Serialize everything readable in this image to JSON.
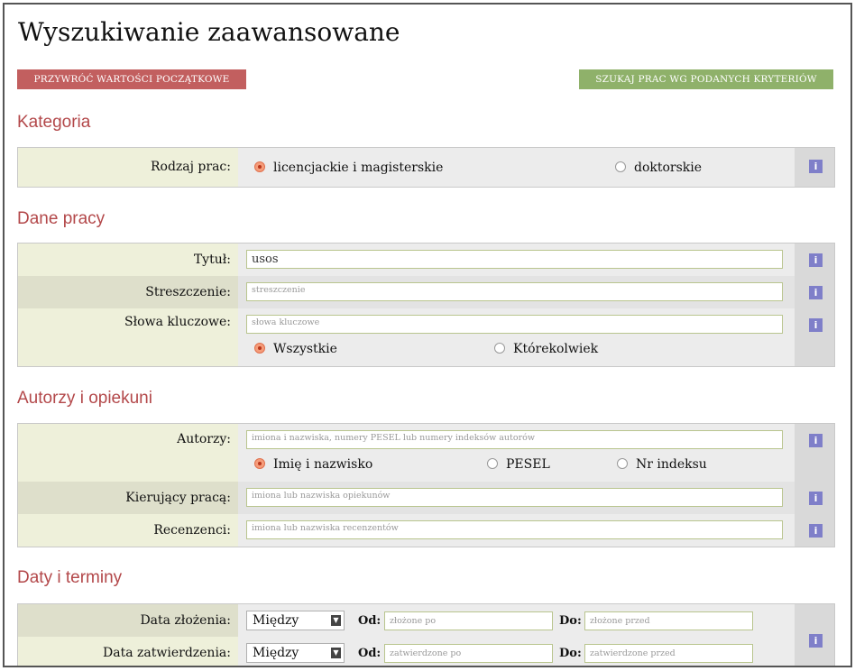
{
  "page": {
    "title": "Wyszukiwanie zaawansowane",
    "reset_label": "PRZYWRÓĆ WARTOŚCI POCZĄTKOWE",
    "search_label": "SZUKAJ PRAC WG PODANYCH KRYTERIÓW"
  },
  "info_icon": "i",
  "kategoria": {
    "title": "Kategoria",
    "rodzaj_label": "Rodzaj prac:",
    "options": [
      "licencjackie i magisterskie",
      "doktorskie"
    ],
    "selected": 0
  },
  "dane": {
    "title": "Dane pracy",
    "tytul_label": "Tytuł:",
    "tytul_value": "usos",
    "streszczenie_label": "Streszczenie:",
    "streszczenie_placeholder": "streszczenie",
    "slowa_label": "Słowa kluczowe:",
    "slowa_placeholder": "słowa kluczowe",
    "match_options": [
      "Wszystkie",
      "Którekolwiek"
    ],
    "match_selected": 0
  },
  "autorzy": {
    "title": "Autorzy i opiekuni",
    "autorzy_label": "Autorzy:",
    "autorzy_placeholder": "imiona i nazwiska, numery PESEL lub numery indeksów autorów",
    "type_options": [
      "Imię i nazwisko",
      "PESEL",
      "Nr indeksu"
    ],
    "type_selected": 0,
    "kierujacy_label": "Kierujący pracą:",
    "kierujacy_placeholder": "imiona lub nazwiska opiekunów",
    "recenzenci_label": "Recenzenci:",
    "recenzenci_placeholder": "imiona lub nazwiska recenzentów"
  },
  "daty": {
    "title": "Daty i terminy",
    "zlozenia_label": "Data złożenia:",
    "zlozenia_select": "Między",
    "od_label": "Od:",
    "do_label": "Do:",
    "zlozenia_od_placeholder": "złożone po",
    "zlozenia_do_placeholder": "złożone przed",
    "zatwierdzenia_label": "Data zatwierdzenia:",
    "zatwierdzenia_select": "Między",
    "zatwierdzenia_od_placeholder": "zatwierdzone po",
    "zatwierdzenia_do_placeholder": "zatwierdzone przed"
  }
}
